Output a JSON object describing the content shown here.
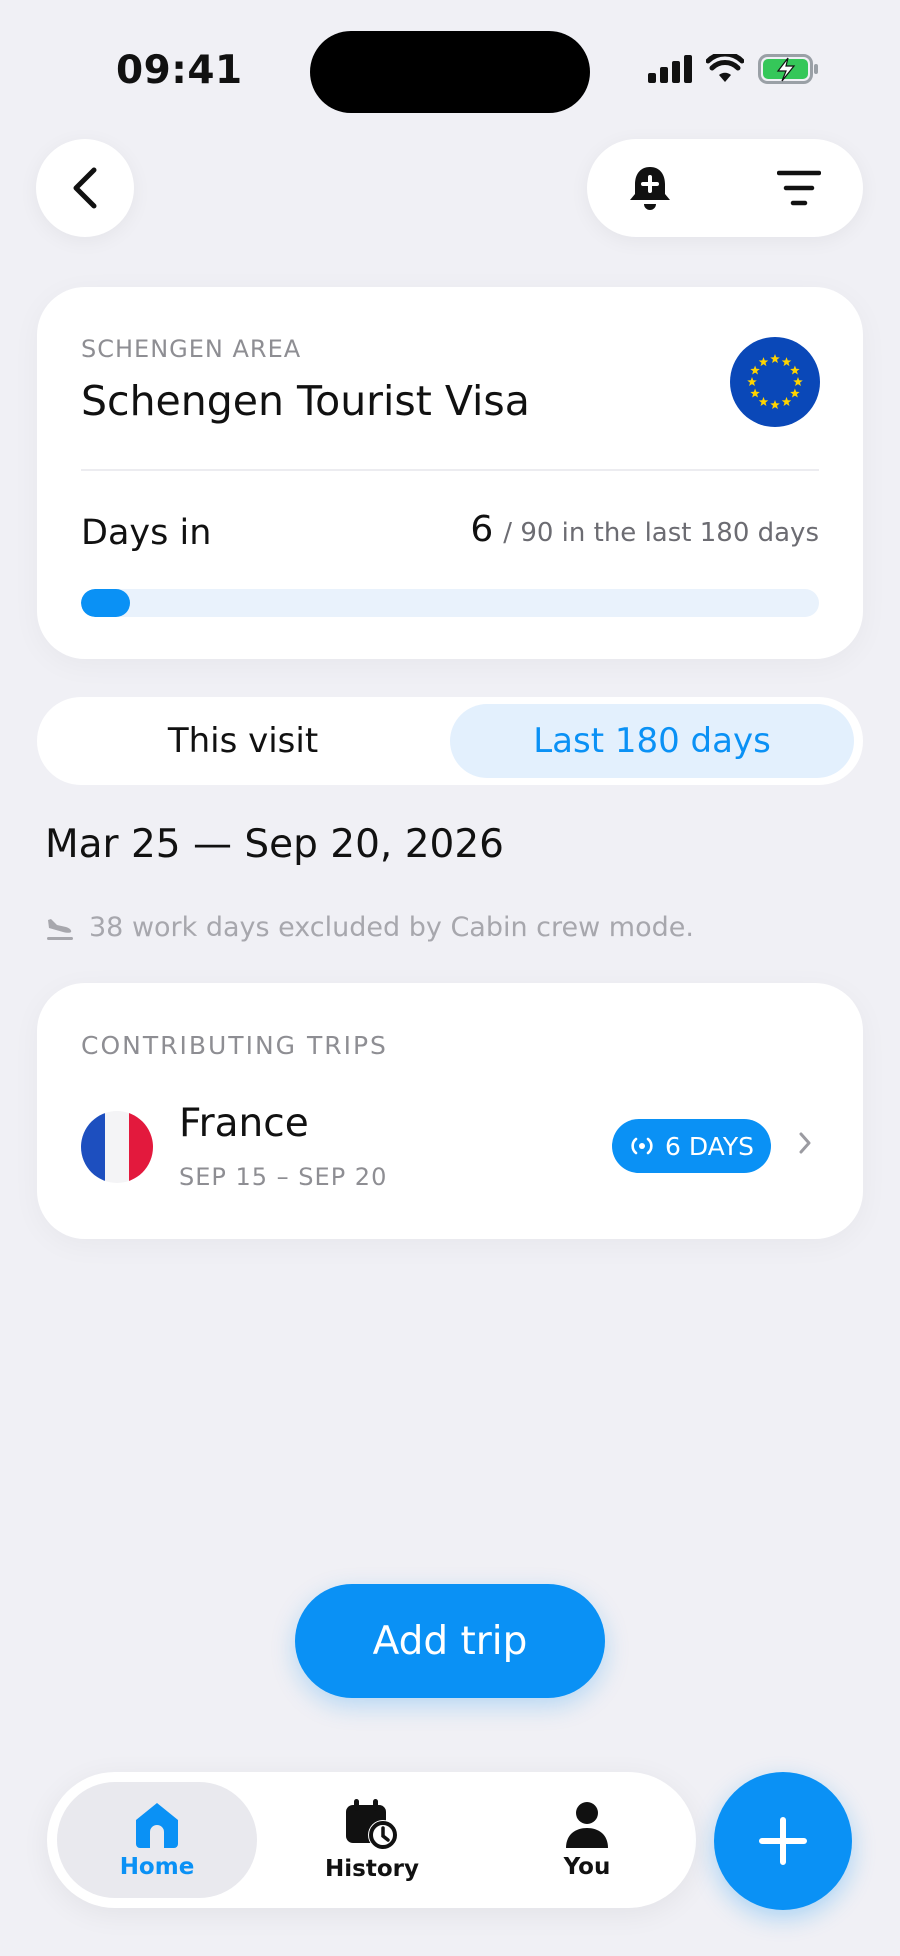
{
  "status_bar": {
    "time": "09:41"
  },
  "visa": {
    "region": "SCHENGEN AREA",
    "title": "Schengen Tourist Visa",
    "days_label": "Days in",
    "days_used": "6",
    "days_limit_text": "/ 90 in the last 180 days",
    "progress_fraction": 0.067
  },
  "segments": {
    "this_visit": "This visit",
    "last_180": "Last 180 days",
    "selected": "last_180"
  },
  "date_range": "Mar 25 — Sep 20, 2026",
  "exclusion_note": "38 work days excluded by Cabin crew mode.",
  "trips": {
    "heading": "CONTRIBUTING TRIPS",
    "items": [
      {
        "country": "France",
        "dates": "SEP 15 – SEP 20",
        "days_badge": "6 DAYS"
      }
    ]
  },
  "add_trip_label": "Add trip",
  "tabbar": {
    "home": "Home",
    "history": "History",
    "you": "You",
    "active": "home"
  },
  "colors": {
    "accent": "#0a91f5",
    "background": "#f0f0f5",
    "eu_blue": "#0a48b8",
    "eu_star": "#ffd400"
  },
  "icons": [
    "back-chevron-icon",
    "bell-plus-icon",
    "filter-lines-icon",
    "eu-flag-icon",
    "airplane-landing-icon",
    "france-flag-icon",
    "broadcast-icon",
    "chevron-right-icon",
    "home-icon",
    "calendar-clock-icon",
    "person-icon",
    "plus-icon"
  ]
}
